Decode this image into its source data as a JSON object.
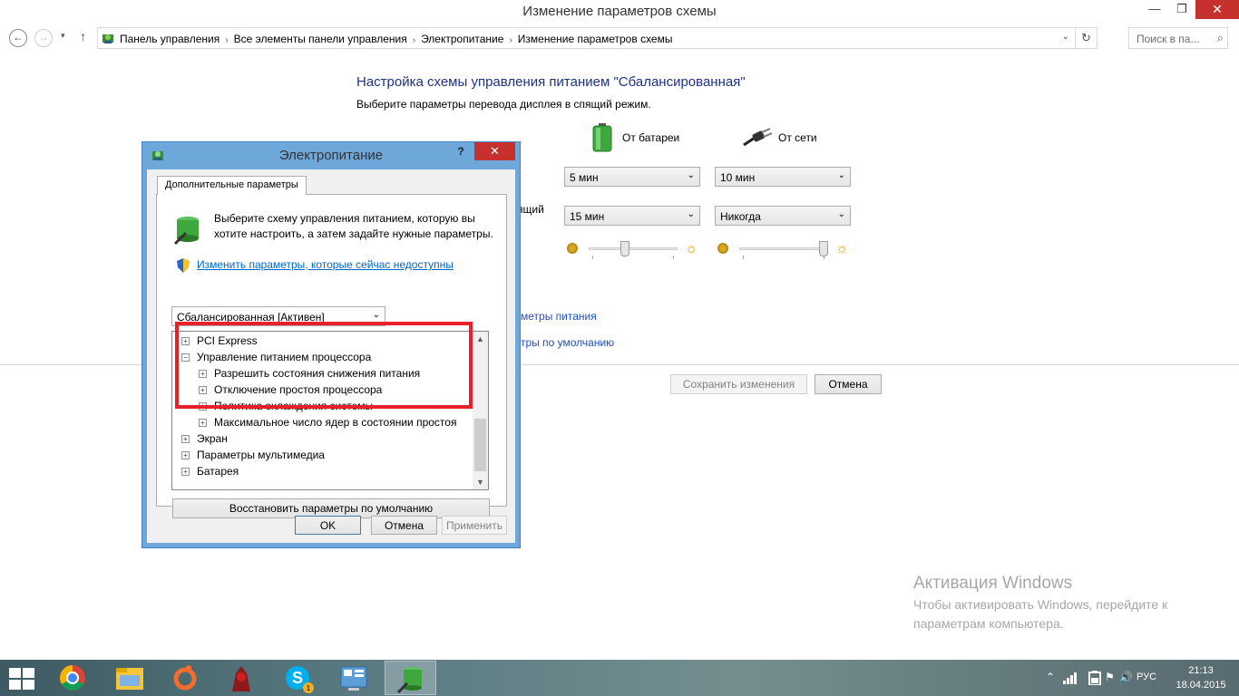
{
  "window": {
    "title": "Изменение параметров схемы",
    "min_glyph": "—",
    "max_glyph": "❐",
    "close_glyph": "✕"
  },
  "nav": {
    "back_glyph": "←",
    "forward_glyph": "→",
    "history_glyph": "▾",
    "up_glyph": "↑",
    "breadcrumbs": [
      "Панель управления",
      "Все элементы панели управления",
      "Электропитание",
      "Изменение параметров схемы"
    ],
    "sep_glyph": "›",
    "dropdown_glyph": "⌄",
    "refresh_glyph": "↻",
    "search_placeholder": "Поиск в па...",
    "search_glyph": "⌕"
  },
  "main": {
    "heading": "Настройка схемы управления питанием \"Сбалансированная\"",
    "subheading": "Выберите параметры перевода дисплея в спящий режим.",
    "battery_label": "От батареи",
    "ac_label": "От сети",
    "partial_sleep_label": "ящий",
    "display_off_battery": "5 мин",
    "display_off_ac": "10 мин",
    "sleep_battery": "15 мин",
    "sleep_ac": "Никогда",
    "brightness_battery": 0.4,
    "brightness_ac": 1.0,
    "link_advanced_partial": "метры питания",
    "link_restore_partial": "тры по умолчанию",
    "save_label": "Сохранить изменения",
    "cancel_label": "Отмена",
    "select_glyph": "⌄",
    "sun_glyph": "☼"
  },
  "dialog": {
    "title": "Электропитание",
    "help_glyph": "?",
    "close_glyph": "✕",
    "tab_label": "Дополнительные параметры",
    "intro": "Выберите схему управления питанием, которую вы хотите настроить, а затем задайте нужные параметры.",
    "link_label": "Изменить параметры, которые сейчас недоступны",
    "scheme_value": "Сбалансированная [Активен]",
    "tree": [
      {
        "label": "PCI Express",
        "expand": "+"
      },
      {
        "label": "Управление питанием процессора",
        "expand": "−"
      },
      {
        "label": "Разрешить состояния снижения питания",
        "expand": "+"
      },
      {
        "label": "Отключение простоя процессора",
        "expand": "+"
      },
      {
        "label": "Политика охлаждения системы",
        "expand": "+"
      },
      {
        "label": "Максимальное число ядер в состоянии простоя",
        "expand": "+"
      },
      {
        "label": "Экран",
        "expand": "+"
      },
      {
        "label": "Параметры мультимедиа",
        "expand": "+"
      },
      {
        "label": "Батарея",
        "expand": "+"
      }
    ],
    "scroll_up_glyph": "▲",
    "scroll_down_glyph": "▼",
    "restore_label": "Восстановить параметры по умолчанию",
    "ok_label": "OK",
    "cancel_label": "Отмена",
    "apply_label": "Применить"
  },
  "watermark": {
    "title": "Активация Windows",
    "text": "Чтобы активировать Windows, перейдите к параметрам компьютера."
  },
  "taskbar": {
    "apps": [
      "chrome-icon",
      "file-explorer-icon",
      "origin-icon",
      "game-icon",
      "skype-icon",
      "control-panel-icon",
      "power-options-icon"
    ],
    "skype_badge": "1",
    "language": "РУС",
    "time": "21:13",
    "date": "18.04.2015",
    "tray_up_glyph": "⌃",
    "tray_flag_glyph": "⚑",
    "tray_volume_glyph": "🔊"
  },
  "colors": {
    "heading": "#1e3287",
    "link": "#0066cc",
    "highlight": "#e8202a",
    "close": "#c7312d",
    "dialog_frame": "#6ea8db"
  }
}
